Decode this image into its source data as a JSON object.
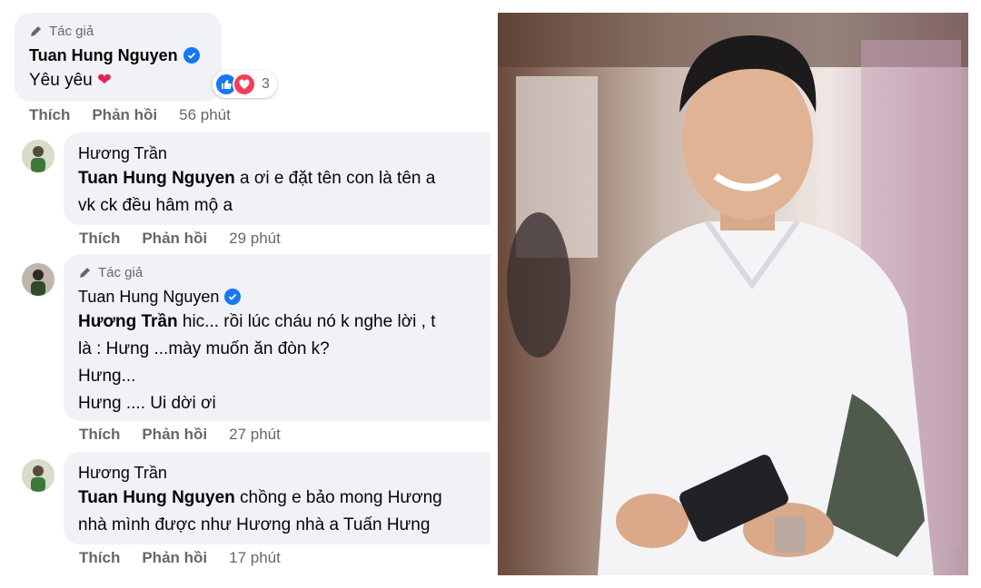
{
  "author_badge_label": "Tác giả",
  "comments": [
    {
      "author": "Tuan Hung Nguyen",
      "text": "Yêu yêu",
      "reactions_count": "3",
      "actions": {
        "like": "Thích",
        "reply": "Phản hồi",
        "time": "56 phút"
      }
    },
    {
      "author": "Hương Trần",
      "mention": "Tuan Hung Nguyen",
      "line1": "a ơi e đặt tên con là tên a",
      "line2": "vk ck đều hâm mộ a",
      "actions": {
        "like": "Thích",
        "reply": "Phản hồi",
        "time": "29 phút"
      }
    },
    {
      "author": "Tuan Hung Nguyen",
      "mention": "Hương Trần",
      "line1": "hic... rồi lúc cháu nó k nghe lời , t",
      "line2": "là : Hưng ...mày muốn ăn đòn k?",
      "line3": "Hưng...",
      "line4": "Hưng .... Ui dời ơi",
      "actions": {
        "like": "Thích",
        "reply": "Phản hồi",
        "time": "27 phút"
      }
    },
    {
      "author": "Hương Trần",
      "mention": "Tuan Hung Nguyen",
      "line1": "chồng e bảo mong Hương",
      "line2": "nhà mình được như Hương nhà a Tuấn Hưng",
      "actions": {
        "like": "Thích",
        "reply": "Phản hồi",
        "time": "17 phút"
      }
    }
  ],
  "colors": {
    "bubble": "#f0f2f5",
    "meta": "#65676b",
    "verified": "#1877f2",
    "love": "#f33e58"
  }
}
